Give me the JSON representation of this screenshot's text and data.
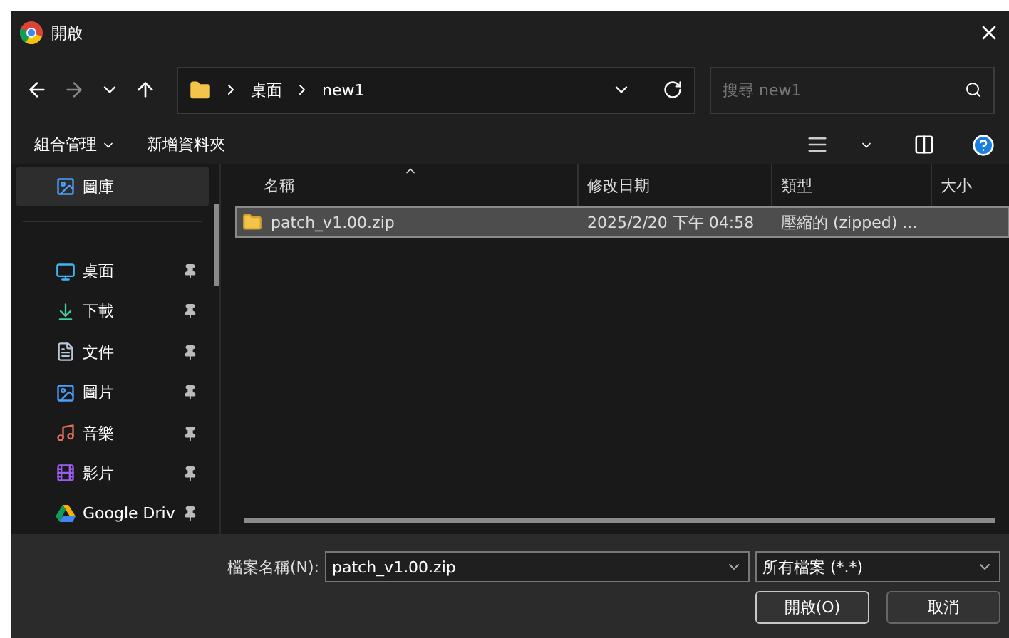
{
  "window": {
    "title": "開啟"
  },
  "address": {
    "crumbs": [
      "桌面",
      "new1"
    ]
  },
  "search": {
    "placeholder": "搜尋 new1"
  },
  "toolbar": [
    {
      "label": "組合管理",
      "menu": true
    },
    {
      "label": "新增資料夾",
      "menu": false
    }
  ],
  "sidebar": {
    "items": [
      {
        "label": "圖庫",
        "selected": true,
        "pinned": false
      },
      {
        "label": "桌面",
        "selected": false,
        "pinned": true
      },
      {
        "label": "下載",
        "selected": false,
        "pinned": true
      },
      {
        "label": "文件",
        "selected": false,
        "pinned": true
      },
      {
        "label": "圖片",
        "selected": false,
        "pinned": true
      },
      {
        "label": "音樂",
        "selected": false,
        "pinned": true
      },
      {
        "label": "影片",
        "selected": false,
        "pinned": true
      },
      {
        "label": "Google Driv",
        "selected": false,
        "pinned": true
      }
    ]
  },
  "table": {
    "columns": [
      "名稱",
      "修改日期",
      "類型",
      "大小"
    ],
    "rows": [
      {
        "name": "patch_v1.00.zip",
        "date": "2025/2/20 下午 04:58",
        "type": "壓縮的 (zipped) ...",
        "size": "",
        "selected": true
      }
    ]
  },
  "footer": {
    "filename_label": "檔案名稱(N):",
    "filename": "patch_v1.00.zip",
    "filter": "所有檔案 (*.*)",
    "buttons": [
      {
        "label": "開啟(O)",
        "default": true
      },
      {
        "label": "取消",
        "default": false
      }
    ]
  }
}
